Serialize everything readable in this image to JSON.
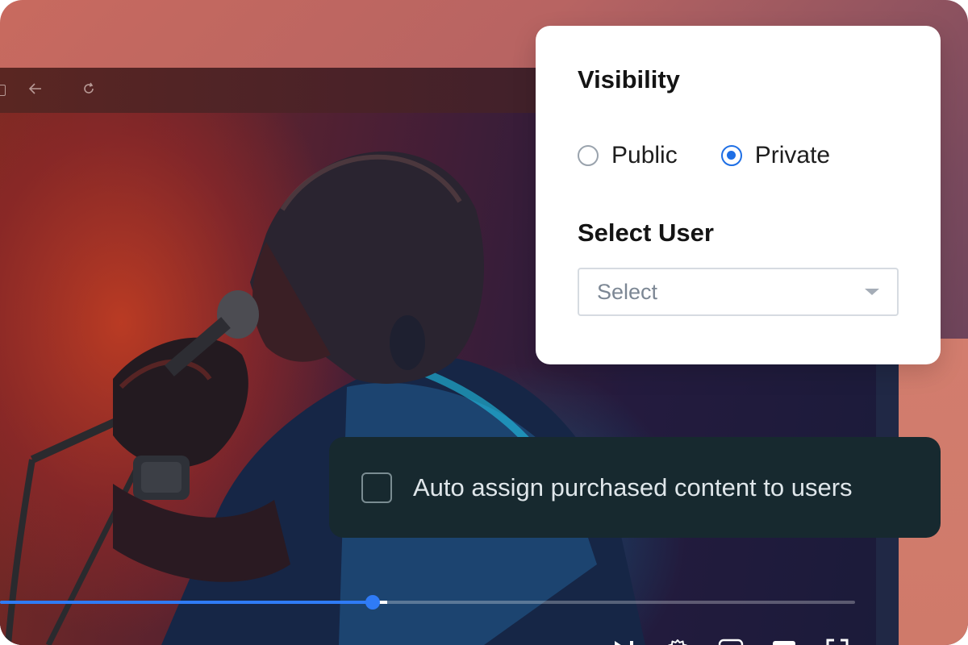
{
  "browser": {
    "toolbar_icons": [
      "tab-icon",
      "back-arrow-icon",
      "reload-icon"
    ]
  },
  "video_player": {
    "progress": 0.436,
    "buffered": 0.453,
    "controls": [
      "next-track-icon",
      "settings-gear-icon",
      "picture-in-picture-icon",
      "subtitles-icon",
      "fullscreen-icon"
    ],
    "accent_color": "#2f7bf6"
  },
  "visibility_panel": {
    "title": "Visibility",
    "options": [
      {
        "label": "Public",
        "checked": false
      },
      {
        "label": "Private",
        "checked": true
      }
    ],
    "select_user_label": "Select User",
    "select_placeholder": "Select"
  },
  "auto_assign": {
    "label": "Auto assign purchased content to users",
    "checked": false
  }
}
